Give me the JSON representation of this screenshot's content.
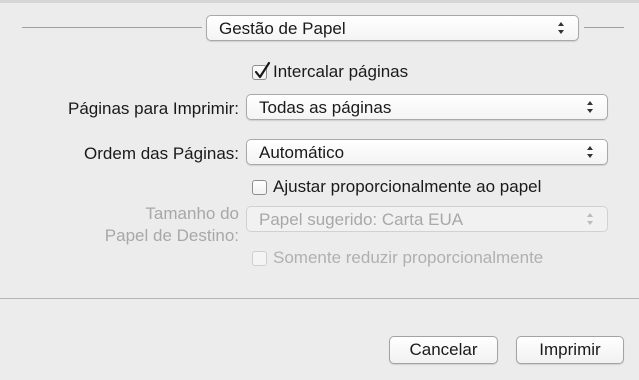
{
  "header": {
    "section_popup": "Gestão de Papel"
  },
  "options": {
    "collate_label": "Intercalar páginas",
    "collate_checked": true,
    "pages_label": "Páginas para Imprimir:",
    "pages_value": "Todas as páginas",
    "order_label": "Ordem das Páginas:",
    "order_value": "Automático",
    "scale_label": "Ajustar proporcionalmente ao papel",
    "scale_checked": false,
    "dest_size_label_line1": "Tamanho do",
    "dest_size_label_line2": "Papel de Destino:",
    "dest_size_value": "Papel sugerido: Carta EUA",
    "scale_down_label": "Somente reduzir proporcionalmente",
    "scale_down_checked": false
  },
  "footer": {
    "cancel_label": "Cancelar",
    "print_label": "Imprimir"
  }
}
